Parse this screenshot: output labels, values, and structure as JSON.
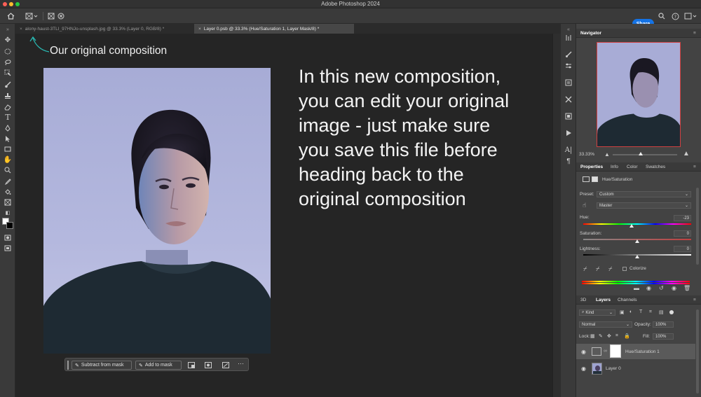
{
  "window": {
    "title": "Adobe Photoshop 2024"
  },
  "optionsbar": {
    "share_label": "Share"
  },
  "tabs": [
    {
      "label": "alony-haust-3TLI_97HNJo-unsplash.jpg @ 33.3% (Layer 0, RGB/8) *",
      "close": "×"
    },
    {
      "label": "Layer 0.psb @ 33.3% (Hue/Saturation 1, Layer Mask/8) *",
      "close": "×"
    }
  ],
  "canvas": {
    "annotation": "Our original composition",
    "note_lines": [
      "In this new composition,",
      "you can edit your original",
      "image - just make sure",
      "you save this file before",
      "heading back to the",
      "original composition"
    ]
  },
  "taskbar": {
    "subtract_label": "Subtract from mask",
    "add_label": "Add to mask",
    "more": "···"
  },
  "navigator": {
    "title": "Navigator",
    "zoom": "33.33%"
  },
  "properties": {
    "tabs": [
      "Properties",
      "Info",
      "Color",
      "Swatches"
    ],
    "adjustment_title": "Hue/Saturation",
    "preset_label": "Preset:",
    "preset_value": "Custom",
    "channel_value": "Master",
    "hue_label": "Hue:",
    "hue_value": "-23",
    "hue_level": 0.45,
    "saturation_label": "Saturation:",
    "saturation_value": "0",
    "saturation_level": 0.5,
    "lightness_label": "Lightness:",
    "lightness_value": "0",
    "lightness_level": 0.5,
    "colorize_label": "Colorize"
  },
  "layers": {
    "tabs": [
      "3D",
      "Layers",
      "Channels"
    ],
    "kind_label": "Kind",
    "blend_mode": "Normal",
    "opacity_label": "Opacity:",
    "opacity_value": "100%",
    "lock_label": "Lock:",
    "fill_label": "Fill:",
    "fill_value": "100%",
    "items": [
      {
        "name": "Hue/Saturation 1"
      },
      {
        "name": "Layer 0"
      }
    ]
  },
  "colors": {
    "accent": "#1473e6",
    "canvas": "#252525",
    "panel": "#434343"
  }
}
